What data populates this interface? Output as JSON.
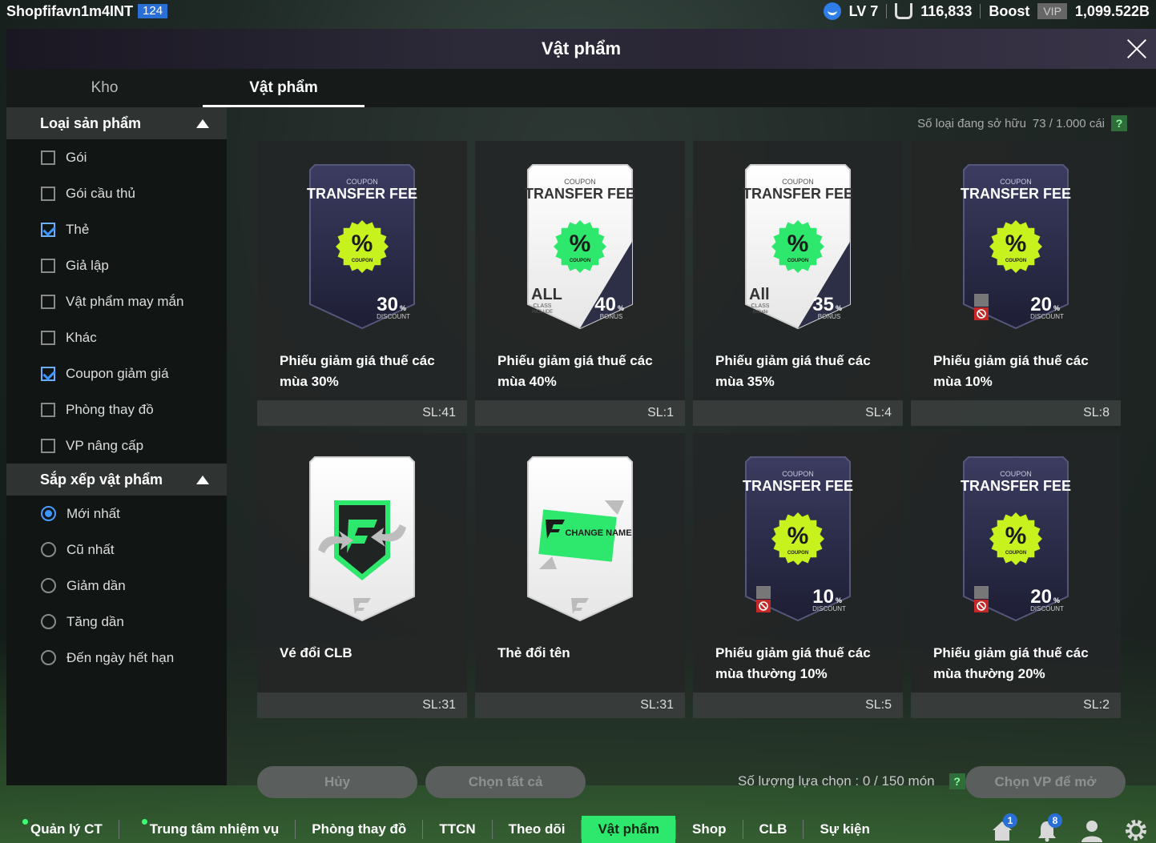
{
  "topbar": {
    "username": "Shopfifavn1m4INT",
    "user_badge": "124",
    "level": "LV 7",
    "coins": "116,833",
    "boost_label": "Boost",
    "vip_label": "VIP",
    "balance": "1,099.522B"
  },
  "window": {
    "title": "Vật phẩm"
  },
  "tabs": [
    {
      "label": "Kho"
    },
    {
      "label": "Vật phẩm"
    }
  ],
  "sidebar": {
    "category": {
      "title": "Loại sản phẩm",
      "options": [
        {
          "label": "Gói",
          "checked": false
        },
        {
          "label": "Gói cầu thủ",
          "checked": false
        },
        {
          "label": "Thẻ",
          "checked": true
        },
        {
          "label": "Giả lập",
          "checked": false
        },
        {
          "label": "Vật phẩm may mắn",
          "checked": false
        },
        {
          "label": "Khác",
          "checked": false
        },
        {
          "label": "Coupon giảm giá",
          "checked": true
        },
        {
          "label": "Phòng thay đồ",
          "checked": false
        },
        {
          "label": "VP nâng cấp",
          "checked": false
        }
      ]
    },
    "sort": {
      "title": "Sắp xếp vật phẩm",
      "options": [
        {
          "label": "Mới nhất",
          "selected": true
        },
        {
          "label": "Cũ nhất",
          "selected": false
        },
        {
          "label": "Giảm dần",
          "selected": false
        },
        {
          "label": "Tăng dần",
          "selected": false
        },
        {
          "label": "Đến ngày hết hạn",
          "selected": false
        }
      ]
    }
  },
  "main": {
    "owned_label": "Số loại đang sở hữu",
    "owned_value": "73 / 1.000 cái",
    "help_label": "?",
    "items": [
      {
        "name": "Phiếu giảm giá thuế các mùa 30%",
        "qty": "SL:41",
        "kind": "coupon",
        "theme": "dark",
        "coupon_top": "COUPON",
        "coupon_title": "TRANSFER FEE",
        "badge_text": "COUPON",
        "percent": "30",
        "unit": "%",
        "sub": "DISCOUNT",
        "corner": "",
        "corner_sub": "",
        "corner_sub2": ""
      },
      {
        "name": "Phiếu giảm giá thuế các mùa 40%",
        "qty": "SL:1",
        "kind": "coupon",
        "theme": "light",
        "coupon_top": "COUPON",
        "coupon_title": "TRANSFER FEE",
        "badge_text": "COUPON",
        "percent": "40",
        "unit": "%",
        "sub": "BONUS",
        "corner": "ALL",
        "corner_sub": "CLASS",
        "corner_sub2": "INCLUDE"
      },
      {
        "name": "Phiếu giảm giá thuế các mùa 35%",
        "qty": "SL:4",
        "kind": "coupon",
        "theme": "light",
        "coupon_top": "COUPON",
        "coupon_title": "TRANSFER FEE",
        "badge_text": "COUPON",
        "percent": "35",
        "unit": "%",
        "sub": "BONUS",
        "corner": "All",
        "corner_sub": "CLASS",
        "corner_sub2": "Include"
      },
      {
        "name": "Phiếu giảm giá thuế các mùa 10%",
        "qty": "SL:8",
        "kind": "coupon",
        "theme": "dark",
        "coupon_top": "COUPON",
        "coupon_title": "TRANSFER FEE",
        "badge_text": "COUPON",
        "percent": "20",
        "unit": "%",
        "sub": "DISCOUNT",
        "corner": "block-icon",
        "corner_sub": "",
        "corner_sub2": ""
      },
      {
        "name": "Vé đổi CLB",
        "qty": "SL:31",
        "kind": "club",
        "theme": "light"
      },
      {
        "name": "Thẻ đổi tên",
        "qty": "SL:31",
        "kind": "rename",
        "theme": "light",
        "rename_text": "CHANGE NAME"
      },
      {
        "name": "Phiếu giảm giá thuế các mùa thường 10%",
        "qty": "SL:5",
        "kind": "coupon",
        "theme": "dark",
        "coupon_top": "COUPON",
        "coupon_title": "TRANSFER FEE",
        "badge_text": "COUPON",
        "percent": "10",
        "unit": "%",
        "sub": "DISCOUNT",
        "corner": "block-icon",
        "corner_sub": "",
        "corner_sub2": ""
      },
      {
        "name": "Phiếu giảm giá thuế các mùa thường 20%",
        "qty": "SL:2",
        "kind": "coupon",
        "theme": "dark",
        "coupon_top": "COUPON",
        "coupon_title": "TRANSFER FEE",
        "badge_text": "COUPON",
        "percent": "20",
        "unit": "%",
        "sub": "DISCOUNT",
        "corner": "block-icon",
        "corner_sub": "",
        "corner_sub2": ""
      }
    ],
    "cancel_label": "Hủy",
    "select_all_label": "Chọn tất cả",
    "selection_label": "Số lượng lựa chọn : 0 / 150 món",
    "open_label": "Chọn VP để mở"
  },
  "nav": {
    "items": [
      {
        "label": "Quản lý CT",
        "dot": true,
        "active": false
      },
      {
        "label": "Trung tâm nhiệm vụ",
        "dot": true,
        "active": false
      },
      {
        "label": "Phòng thay đồ",
        "dot": false,
        "active": false
      },
      {
        "label": "TTCN",
        "dot": false,
        "active": false
      },
      {
        "label": "Theo dõi",
        "dot": false,
        "active": false
      },
      {
        "label": "Vật phẩm",
        "dot": false,
        "active": true
      },
      {
        "label": "Shop",
        "dot": false,
        "active": false
      },
      {
        "label": "CLB",
        "dot": false,
        "active": false
      },
      {
        "label": "Sự kiện",
        "dot": false,
        "active": false
      }
    ],
    "home_badge": "1",
    "bell_badge": "8"
  },
  "colors": {
    "accent": "#2ee86e",
    "checkbox": "#3d95ff",
    "coupon_badge": "#c8f21d"
  }
}
